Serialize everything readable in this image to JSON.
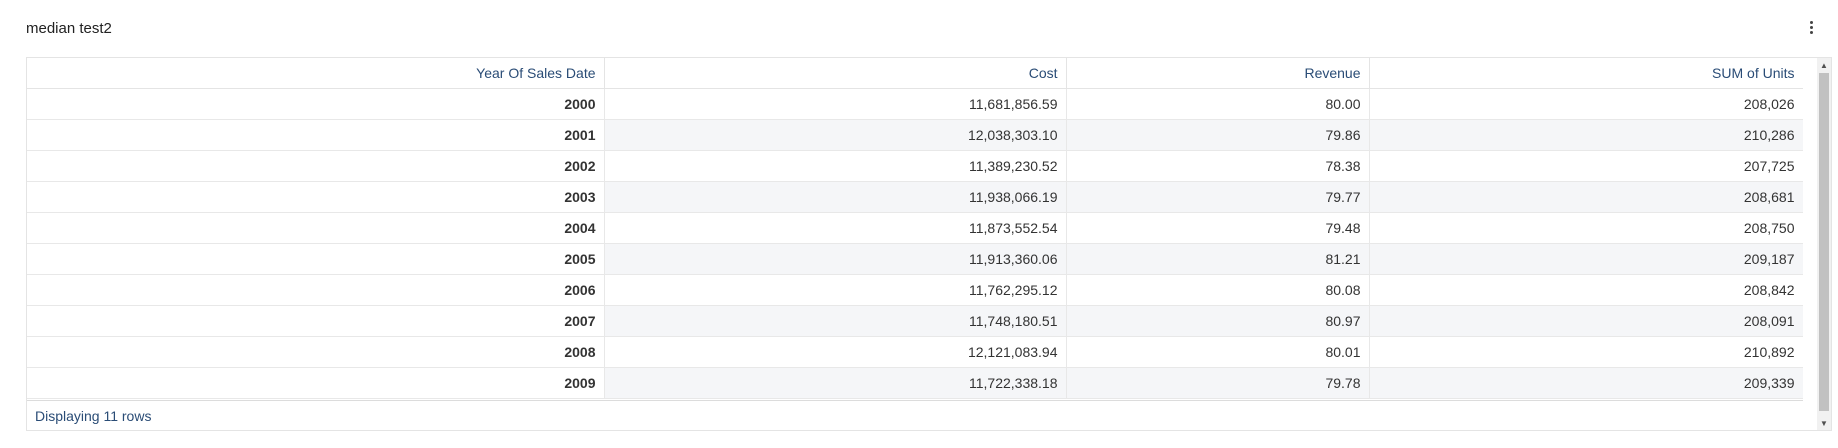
{
  "widget": {
    "title": "median test2"
  },
  "table": {
    "columns": [
      "Year Of Sales Date",
      "Cost",
      "Revenue",
      "SUM of Units"
    ],
    "rows": [
      [
        "2000",
        "11,681,856.59",
        "80.00",
        "208,026"
      ],
      [
        "2001",
        "12,038,303.10",
        "79.86",
        "210,286"
      ],
      [
        "2002",
        "11,389,230.52",
        "78.38",
        "207,725"
      ],
      [
        "2003",
        "11,938,066.19",
        "79.77",
        "208,681"
      ],
      [
        "2004",
        "11,873,552.54",
        "79.48",
        "208,750"
      ],
      [
        "2005",
        "11,913,360.06",
        "81.21",
        "209,187"
      ],
      [
        "2006",
        "11,762,295.12",
        "80.08",
        "208,842"
      ],
      [
        "2007",
        "11,748,180.51",
        "80.97",
        "208,091"
      ],
      [
        "2008",
        "12,121,083.94",
        "80.01",
        "210,892"
      ],
      [
        "2009",
        "11,722,338.18",
        "79.78",
        "209,339"
      ]
    ],
    "footer": "Displaying 11 rows"
  },
  "icons": {
    "menu": "vertical-ellipsis-icon",
    "scroll_up": "triangle-up-icon",
    "scroll_down": "triangle-down-icon"
  },
  "colors": {
    "header_text": "#2a4c76",
    "alt_row": "#f5f6f8",
    "border": "#e4e4e4"
  }
}
